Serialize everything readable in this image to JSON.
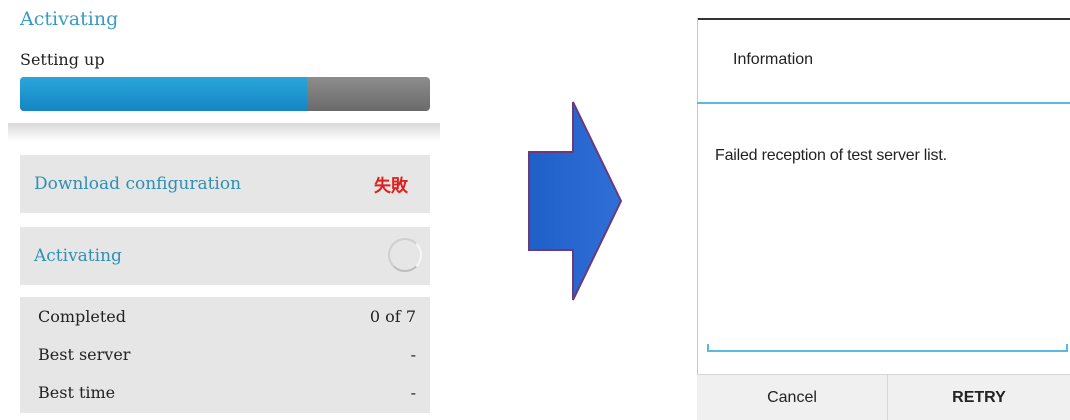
{
  "left": {
    "title": "Activating",
    "setup_label": "Setting up",
    "progress": 0.7,
    "download_row": {
      "label": "Download configuration",
      "status": "失敗"
    },
    "activating_row": {
      "label": "Activating"
    },
    "stats": [
      {
        "key": "Completed",
        "value": "0 of 7"
      },
      {
        "key": "Best server",
        "value": "-"
      },
      {
        "key": "Best time",
        "value": "-"
      }
    ]
  },
  "colors": {
    "accent": "#3a9bc0",
    "progress_fill": "#1e96d0",
    "error": "#e02020",
    "arrow": "#2a5fc4",
    "dialog_rule": "#59b9de"
  },
  "dialog": {
    "title": "Information",
    "message": "Failed reception of test server list.",
    "cancel_label": "Cancel",
    "retry_label": "RETRY"
  }
}
